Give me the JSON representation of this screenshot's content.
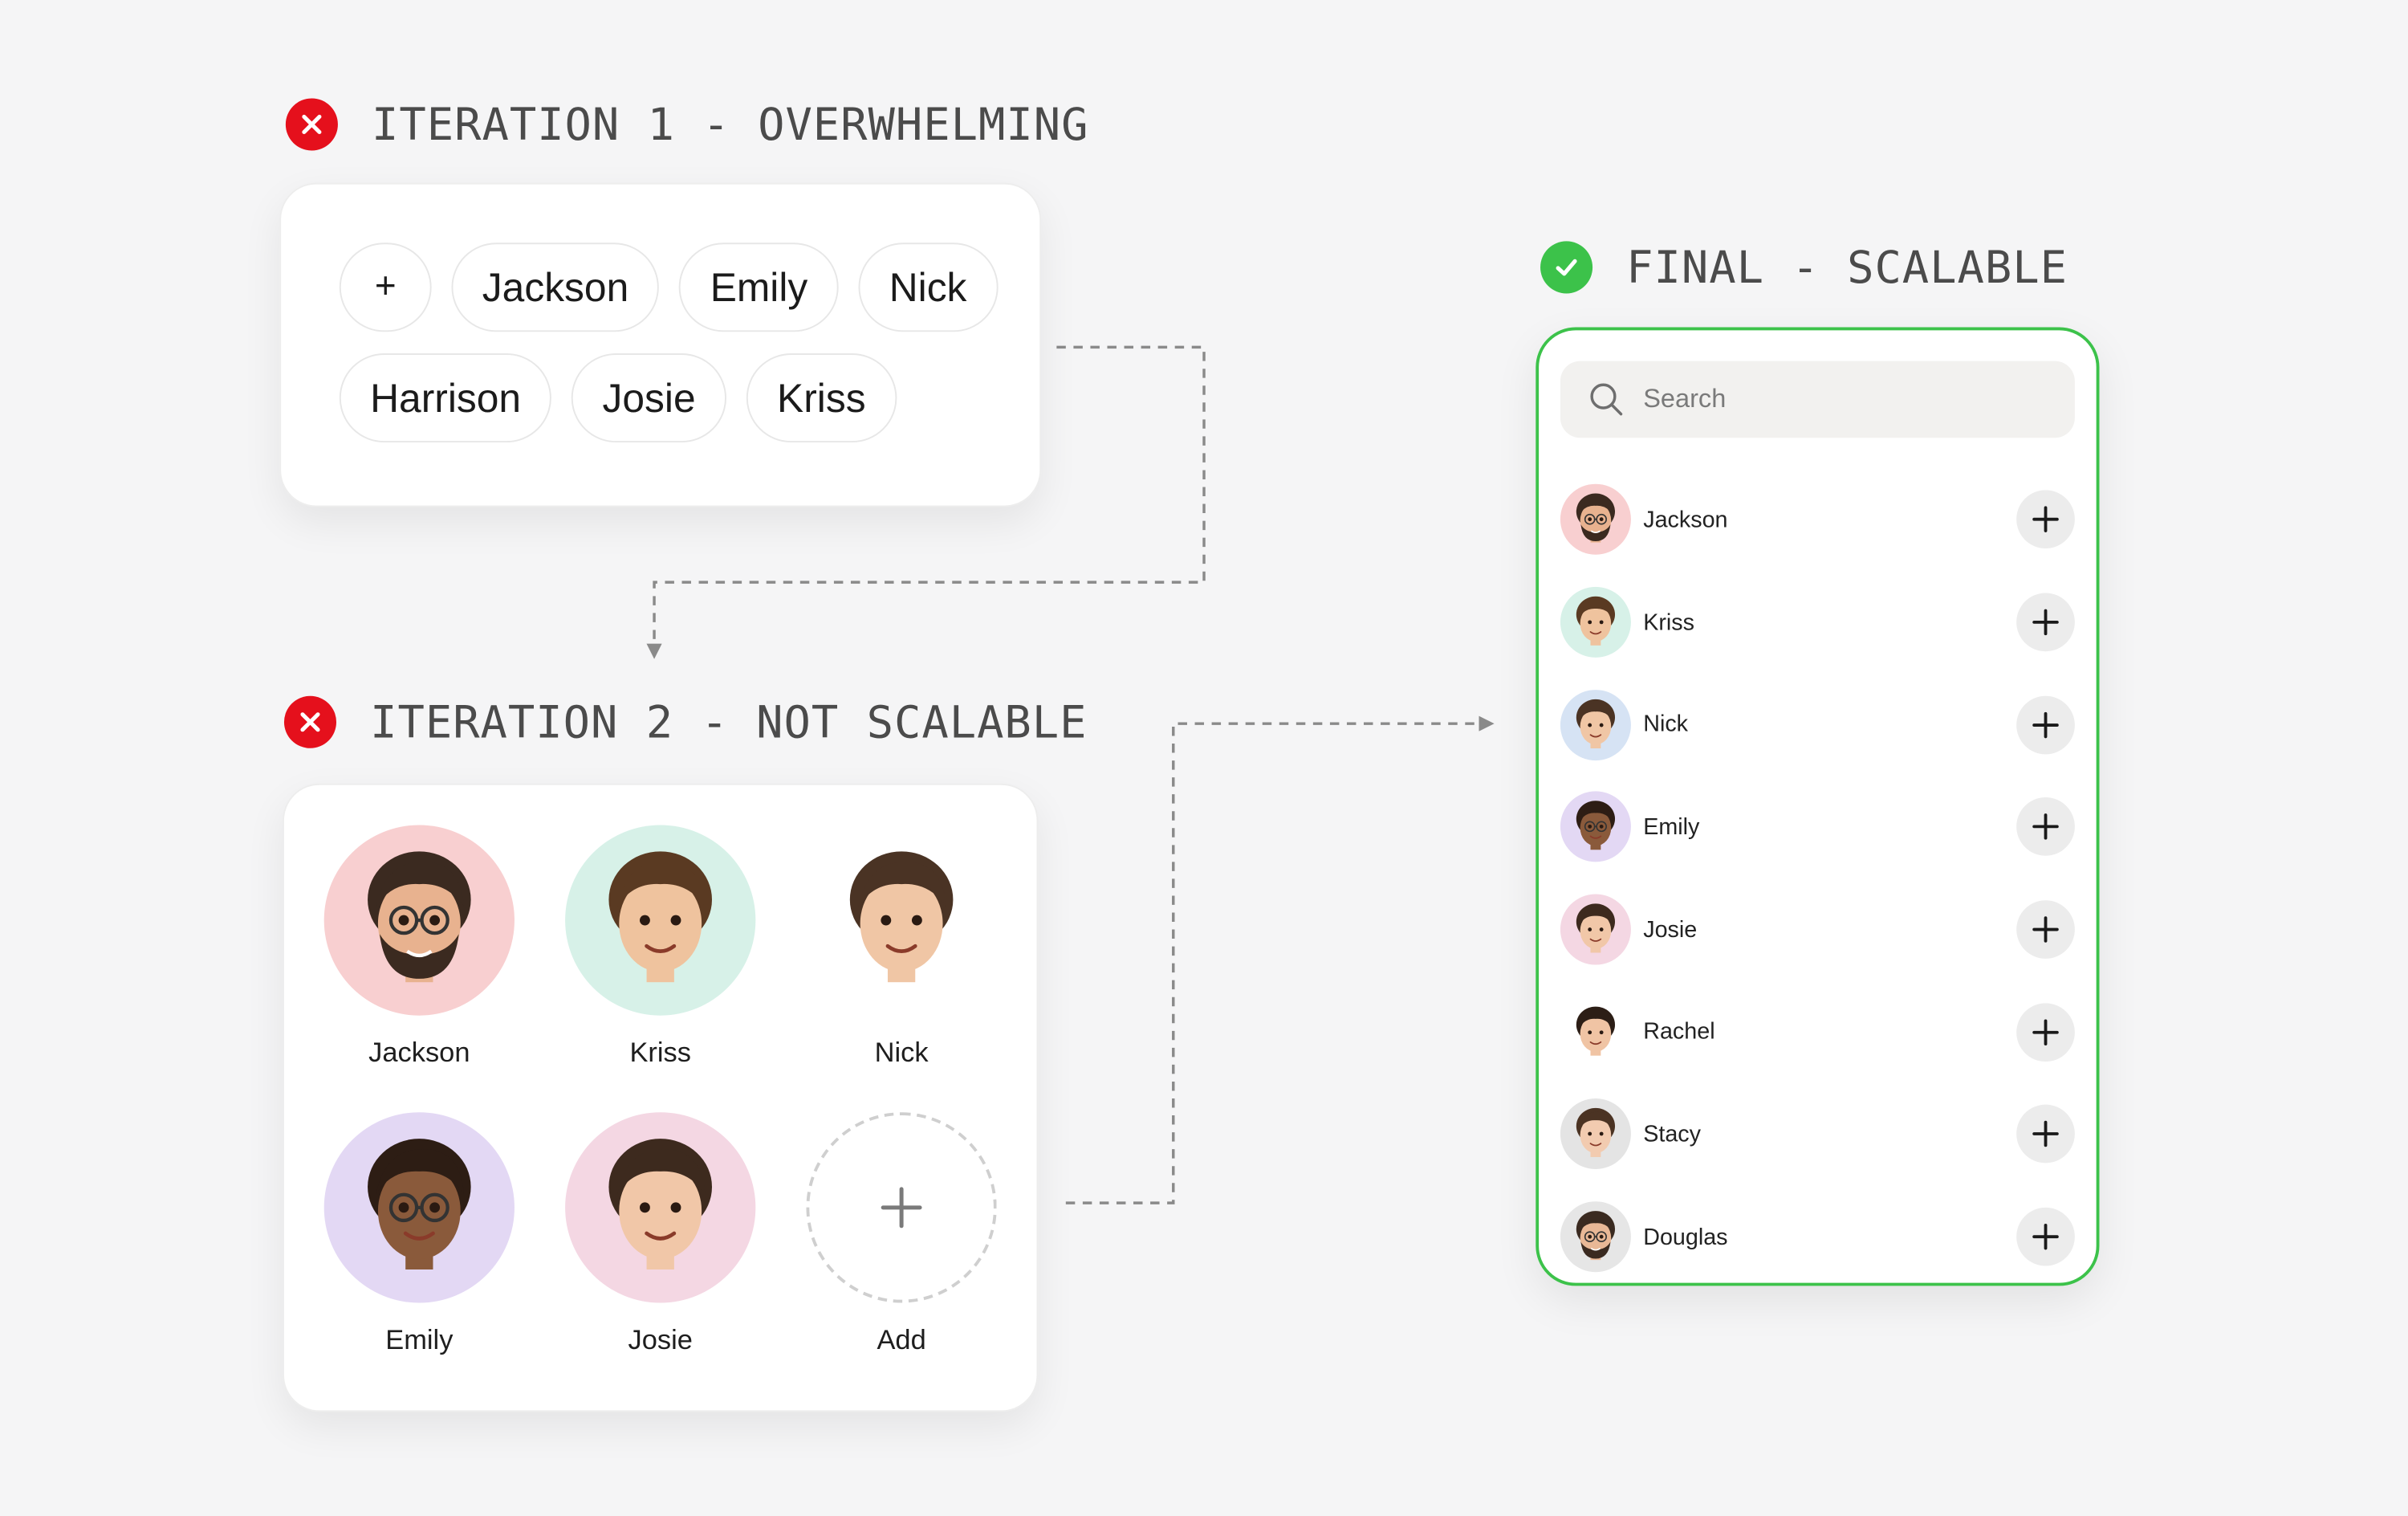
{
  "iteration1": {
    "heading": "ITERATION 1 - OVERWHELMING",
    "status": "fail",
    "add_label": "+",
    "chips": [
      "Jackson",
      "Emily",
      "Nick",
      "Harrison",
      "Josie",
      "Kriss"
    ]
  },
  "iteration2": {
    "heading": "ITERATION 2 - NOT SCALABLE",
    "status": "fail",
    "people": [
      {
        "name": "Jackson",
        "bg": "#f8cfd0",
        "skin": "#e8b28f",
        "hair": "#3b2a20",
        "glasses": true,
        "beard": true
      },
      {
        "name": "Kriss",
        "bg": "#d7f1e8",
        "skin": "#efc39e",
        "hair": "#5a3a22",
        "glasses": false,
        "beard": false
      },
      {
        "name": "Nick",
        "bg": "#ffffff",
        "skin": "#f0c6a5",
        "hair": "#4a3324",
        "glasses": false,
        "beard": false
      },
      {
        "name": "Emily",
        "bg": "#e3d8f4",
        "skin": "#8a5a3b",
        "hair": "#2d1d14",
        "glasses": true,
        "beard": false
      },
      {
        "name": "Josie",
        "bg": "#f4d7e3",
        "skin": "#f1c7a8",
        "hair": "#3d2a1e",
        "glasses": false,
        "beard": false
      }
    ],
    "add_label": "Add",
    "add_icon": "+"
  },
  "final": {
    "heading": "FINAL - SCALABLE",
    "status": "success",
    "search_placeholder": "Search",
    "people": [
      {
        "name": "Jackson",
        "bg": "#f8cfd0",
        "skin": "#e8b28f",
        "hair": "#3b2a20",
        "glasses": true,
        "beard": true
      },
      {
        "name": "Kriss",
        "bg": "#d7f1e8",
        "skin": "#efc39e",
        "hair": "#5a3a22",
        "glasses": false,
        "beard": false
      },
      {
        "name": "Nick",
        "bg": "#d6e3f4",
        "skin": "#f0c6a5",
        "hair": "#4a3324",
        "glasses": false,
        "beard": false
      },
      {
        "name": "Emily",
        "bg": "#e3d8f4",
        "skin": "#8a5a3b",
        "hair": "#2d1d14",
        "glasses": true,
        "beard": false
      },
      {
        "name": "Josie",
        "bg": "#f4d7e3",
        "skin": "#f1c7a8",
        "hair": "#3d2a1e",
        "glasses": false,
        "beard": false
      },
      {
        "name": "Rachel",
        "bg": "#ffffff",
        "skin": "#f0c4a4",
        "hair": "#2c1e16",
        "glasses": false,
        "beard": false
      },
      {
        "name": "Stacy",
        "bg": "#e4e4e4",
        "skin": "#f2cbb0",
        "hair": "#4b3323",
        "glasses": false,
        "beard": false
      },
      {
        "name": "Douglas",
        "bg": "#e6e6e6",
        "skin": "#e9b896",
        "hair": "#3a2a20",
        "glasses": true,
        "beard": true
      }
    ]
  },
  "colors": {
    "fail": "#e5101c",
    "success": "#3cc24a",
    "final_border": "#3cc24a",
    "connector": "#8a8a8a"
  },
  "icons": {
    "fail": "close-icon",
    "success": "check-icon",
    "search": "search-icon",
    "plus": "plus-icon"
  }
}
